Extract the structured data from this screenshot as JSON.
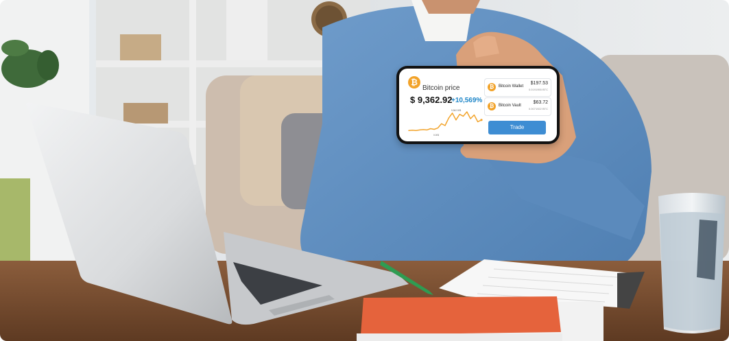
{
  "phone_app": {
    "price_title": "Bitcoin price",
    "price_value": "$ 9,362.92",
    "price_change": "+10,569%",
    "chart_peak_label": "9,362.92$",
    "chart_low_label": "0.00$",
    "wallets": [
      {
        "name": "Bitcoin Wallet",
        "amount": "$197.53",
        "btc": "0.0191955 BTC"
      },
      {
        "name": "Bitcoin Vault",
        "amount": "$63.72",
        "btc": "0.0071922 BTC"
      }
    ],
    "trade_label": "Trade",
    "accent_color": "#f2a32a",
    "button_color": "#3e8dd3",
    "change_color": "#1e86c8"
  },
  "chart_data": {
    "type": "line",
    "x": [
      0,
      1,
      2,
      3,
      4,
      5,
      6,
      7,
      8,
      9,
      10,
      11,
      12,
      13,
      14,
      15,
      16,
      17,
      18,
      19,
      20
    ],
    "values": [
      6,
      7,
      6,
      8,
      9,
      8,
      12,
      10,
      14,
      28,
      22,
      46,
      62,
      40,
      58,
      52,
      66,
      44,
      56,
      34,
      40
    ],
    "color": "#f2a32a"
  },
  "icons": [
    "bitcoin-icon",
    "bitcoin-wallet-icon",
    "bitcoin-vault-icon"
  ]
}
